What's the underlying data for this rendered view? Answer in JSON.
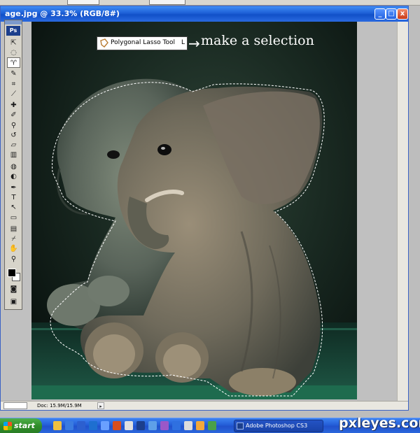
{
  "window": {
    "title": "age.jpg @ 33.3% (RGB/8#)",
    "buttons": [
      "_",
      "□",
      "x"
    ]
  },
  "toolbox": {
    "logo": "Ps",
    "tools": [
      {
        "name": "move-tool",
        "glyph": "⇱"
      },
      {
        "name": "marquee-tool",
        "glyph": "◌"
      },
      {
        "name": "lasso-tool",
        "glyph": "♈",
        "active": true
      },
      {
        "name": "quick-selection-tool",
        "glyph": "✎"
      },
      {
        "name": "crop-tool",
        "glyph": "⌗"
      },
      {
        "name": "slice-tool",
        "glyph": "⟋"
      },
      {
        "name": "healing-brush-tool",
        "glyph": "✚"
      },
      {
        "name": "brush-tool",
        "glyph": "✐"
      },
      {
        "name": "clone-stamp-tool",
        "glyph": "⚲"
      },
      {
        "name": "history-brush-tool",
        "glyph": "↺"
      },
      {
        "name": "eraser-tool",
        "glyph": "▱"
      },
      {
        "name": "gradient-tool",
        "glyph": "▥"
      },
      {
        "name": "blur-tool",
        "glyph": "◍"
      },
      {
        "name": "dodge-tool",
        "glyph": "◐"
      },
      {
        "name": "pen-tool",
        "glyph": "✒"
      },
      {
        "name": "type-tool",
        "glyph": "T"
      },
      {
        "name": "path-selection-tool",
        "glyph": "↖"
      },
      {
        "name": "shape-tool",
        "glyph": "▭"
      },
      {
        "name": "notes-tool",
        "glyph": "▤"
      },
      {
        "name": "eyedropper-tool",
        "glyph": "⌿"
      },
      {
        "name": "hand-tool",
        "glyph": "✋"
      },
      {
        "name": "zoom-tool",
        "glyph": "⚲"
      }
    ]
  },
  "callout": {
    "tool_name": "Polygonal Lasso Tool",
    "shortcut": "L",
    "arrow": "→",
    "caption": "make a selection"
  },
  "statusbar": {
    "doc": "Doc: 15.9M/15.9M",
    "arrow": "▸"
  },
  "taskbar": {
    "start": "start",
    "active_item": "Adobe Photoshop CS3"
  },
  "watermark": "pxleyes.com",
  "colors": {
    "titlebar": "#1d5fd6",
    "taskbar": "#245ed8",
    "start": "#2f8c2a",
    "background": "#0c1612"
  }
}
